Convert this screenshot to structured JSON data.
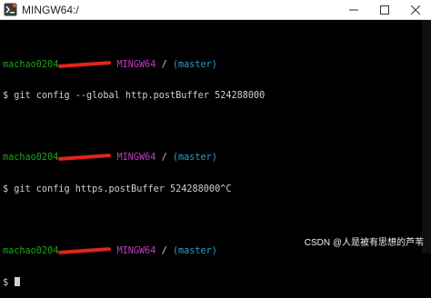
{
  "window": {
    "title": "MINGW64:/",
    "icon": "git-bash-icon"
  },
  "terminal": {
    "blocks": [
      {
        "user": "machao0204",
        "env": "MINGW64",
        "path": "/",
        "branch": "(master)",
        "command": "$ git config --global http.postBuffer 524288000"
      },
      {
        "user": "machao0204",
        "env": "MINGW64",
        "path": "/",
        "branch": "(master)",
        "command": "$ git config https.postBuffer 524288000^C"
      },
      {
        "user": "machao0204",
        "env": "MINGW64",
        "path": "/",
        "branch": "(master)",
        "command": "$ "
      }
    ]
  },
  "watermark": "CSDN @人是被有思想的芦苇",
  "colors": {
    "user": "#1ea31e",
    "env": "#c33ac3",
    "branch": "#2aa0c8",
    "redaction": "#e0241b"
  }
}
